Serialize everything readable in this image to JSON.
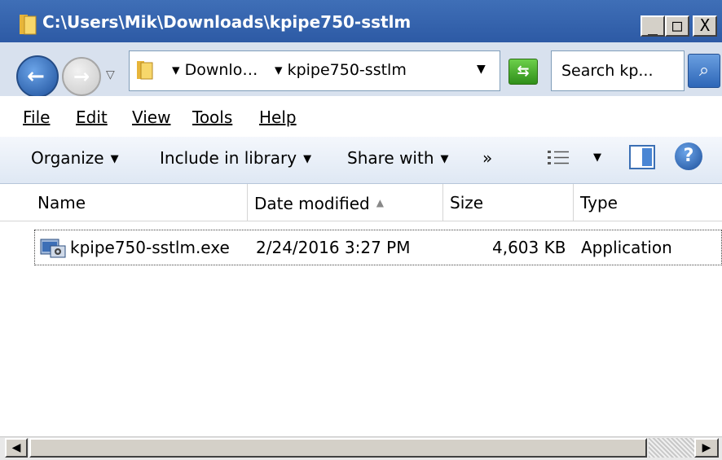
{
  "window": {
    "title": "C:\\Users\\Mik\\Downloads\\kpipe750-sstlm"
  },
  "title_buttons": {
    "minimize": "_",
    "maximize": "□",
    "close": "X"
  },
  "address": {
    "crumbs": [
      "Downlo…",
      "kpipe750-sstlm"
    ],
    "search_placeholder": "Search kp..."
  },
  "menu": [
    "File",
    "Edit",
    "View",
    "Tools",
    "Help"
  ],
  "commands": {
    "organize": "Organize",
    "include": "Include in library",
    "share": "Share with",
    "more": "»"
  },
  "columns": [
    "Name",
    "Date modified",
    "Size",
    "Type"
  ],
  "files": [
    {
      "name": "kpipe750-sstlm.exe",
      "date": "2/24/2016 3:27 PM",
      "size": "4,603 KB",
      "type": "Application"
    }
  ],
  "colors": {
    "titlebar": "#3f6fb7",
    "address_bg": "#d8e1ee",
    "accent": "#2d66b8"
  },
  "icons": [
    "folder-icon",
    "back-arrow-icon",
    "forward-arrow-icon",
    "refresh-icon",
    "search-icon",
    "view-list-icon",
    "preview-pane-icon",
    "help-icon",
    "exe-file-icon"
  ]
}
